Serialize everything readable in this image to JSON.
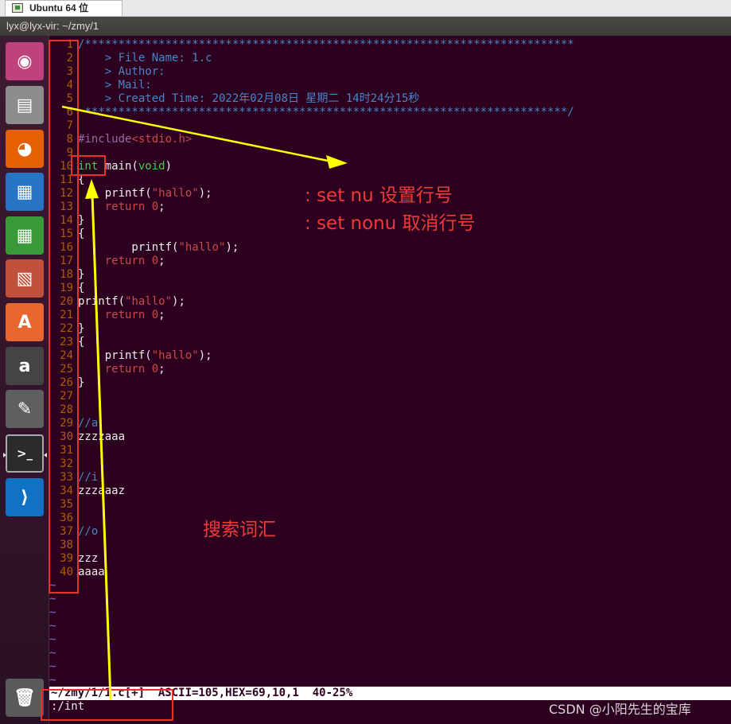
{
  "vm_tab": {
    "label": "Ubuntu 64 位"
  },
  "window": {
    "title": "lyx@lyx-vir: ~/zmy/1"
  },
  "launcher": {
    "items": [
      {
        "name": "ubuntu-dash",
        "icon": "ubuntu-logo-icon"
      },
      {
        "name": "files",
        "icon": "file-cabinet-icon"
      },
      {
        "name": "firefox",
        "icon": "firefox-icon"
      },
      {
        "name": "libreoffice-writer",
        "icon": "writer-document-icon"
      },
      {
        "name": "libreoffice-calc",
        "icon": "calc-spreadsheet-icon"
      },
      {
        "name": "libreoffice-impress",
        "icon": "impress-presentation-icon"
      },
      {
        "name": "software-center",
        "icon": "shopping-bag-icon"
      },
      {
        "name": "amazon",
        "icon": "amazon-icon"
      },
      {
        "name": "system-settings",
        "icon": "wrench-gear-icon"
      },
      {
        "name": "terminal",
        "icon": "terminal-icon"
      },
      {
        "name": "vscode",
        "icon": "vscode-icon"
      }
    ],
    "trash": {
      "name": "trash",
      "icon": "trash-icon"
    },
    "colors": [
      "#c0427a",
      "#8d8d8d",
      "#e66000",
      "#2a74c5",
      "#3a9a3a",
      "#c0513a",
      "#e8662f",
      "#444444",
      "#5f5f5f",
      "#2b2b2b",
      "#0f72c2"
    ]
  },
  "editor": {
    "lines": [
      {
        "n": "1",
        "html": "<span class=\"c-comment\">/*************************************************************************</span>"
      },
      {
        "n": "2",
        "html": "<span class=\"c-comment\">    &gt; File Name: 1.c</span>"
      },
      {
        "n": "3",
        "html": "<span class=\"c-comment\">    &gt; Author:</span>"
      },
      {
        "n": "4",
        "html": "<span class=\"c-comment\">    &gt; Mail:</span>"
      },
      {
        "n": "5",
        "html": "<span class=\"c-comment\">    &gt; Created Time: 2022年02月08日 星期二 14时24分15秒</span>"
      },
      {
        "n": "6",
        "html": "<span class=\"c-comment\"> ************************************************************************/</span>"
      },
      {
        "n": "7",
        "html": ""
      },
      {
        "n": "8",
        "html": "<span class=\"c-pre\">#include<span class=\"c-str\">&lt;stdio.h&gt;</span></span>"
      },
      {
        "n": "9",
        "html": ""
      },
      {
        "n": "10",
        "html": "<span class=\"c-type\">int</span> main(<span class=\"c-type\">void</span>)"
      },
      {
        "n": "11",
        "html": "{"
      },
      {
        "n": "12",
        "html": "    printf(<span class=\"c-str\">\"hallo\"</span>);"
      },
      {
        "n": "13",
        "html": "    <span class=\"c-str\">return</span> <span class=\"c-num\">0</span>;"
      },
      {
        "n": "14",
        "html": "}"
      },
      {
        "n": "15",
        "html": "{"
      },
      {
        "n": "16",
        "html": "        printf(<span class=\"c-str\">\"hallo\"</span>);"
      },
      {
        "n": "17",
        "html": "    <span class=\"c-str\">return</span> <span class=\"c-num\">0</span>;"
      },
      {
        "n": "18",
        "html": "}"
      },
      {
        "n": "19",
        "html": "{"
      },
      {
        "n": "20",
        "html": "printf(<span class=\"c-str\">\"hallo\"</span>);"
      },
      {
        "n": "21",
        "html": "    <span class=\"c-str\">return</span> <span class=\"c-num\">0</span>;"
      },
      {
        "n": "22",
        "html": "}"
      },
      {
        "n": "23",
        "html": "{"
      },
      {
        "n": "24",
        "html": "    printf(<span class=\"c-str\">\"hallo\"</span>);"
      },
      {
        "n": "25",
        "html": "    <span class=\"c-str\">return</span> <span class=\"c-num\">0</span>;"
      },
      {
        "n": "26",
        "html": "}"
      },
      {
        "n": "27",
        "html": ""
      },
      {
        "n": "28",
        "html": ""
      },
      {
        "n": "29",
        "html": "<span class=\"c-comment\">//a</span>"
      },
      {
        "n": "30",
        "html": "zzzzaaa"
      },
      {
        "n": "31",
        "html": ""
      },
      {
        "n": "32",
        "html": ""
      },
      {
        "n": "33",
        "html": "<span class=\"c-comment\">//i</span>"
      },
      {
        "n": "34",
        "html": "zzzaaaz"
      },
      {
        "n": "35",
        "html": ""
      },
      {
        "n": "36",
        "html": ""
      },
      {
        "n": "37",
        "html": "<span class=\"c-comment\">//o</span>"
      },
      {
        "n": "38",
        "html": ""
      },
      {
        "n": "39",
        "html": "zzz"
      },
      {
        "n": "40",
        "html": "aaaa"
      }
    ],
    "tilde": "~",
    "tilde_count": 8,
    "status_line": "~/zmy/1/1.c[+]  ASCII=105,HEX=69,10,1  40-25%",
    "command_line": ":/int"
  },
  "annotations": {
    "set_nu": ": set nu  设置行号",
    "set_nonu": ": set nonu 取消行号",
    "search": "搜索词汇",
    "arrow_color": "#ffff00",
    "box_color": "#e8312f"
  },
  "watermark": "CSDN @小阳先生的宝库"
}
